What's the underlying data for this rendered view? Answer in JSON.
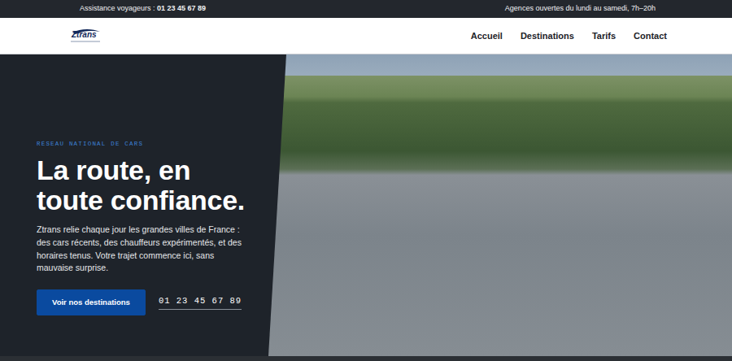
{
  "topbar": {
    "assistance_label": "Assistance voyageurs : ",
    "assistance_phone": "01 23 45 67 89",
    "hours": "Agences ouvertes du lundi au samedi, 7h–20h"
  },
  "nav": {
    "logo": "Ztrans",
    "links": [
      {
        "label": "Accueil",
        "selected": false
      },
      {
        "label": "Destinations",
        "selected": false
      },
      {
        "label": "Tarifs",
        "selected": false
      },
      {
        "label": "Contact",
        "selected": false
      }
    ]
  },
  "hero": {
    "eyebrow": "RÉSEAU NATIONAL DE CARS",
    "title_lines": [
      "La route, en",
      "toute confiance."
    ],
    "text": "Ztrans relie chaque jour les grandes villes de France : des cars récents, des chauffeurs expérimentés, et des horaires tenus. Votre trajet commence ici, sans mauvaise surprise.",
    "cta": "Voir nos destinations",
    "phone": "01 23 45 67 89"
  }
}
